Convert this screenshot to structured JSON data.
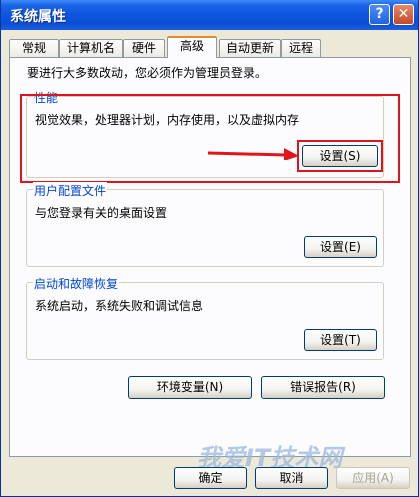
{
  "window": {
    "title": "系统属性",
    "help_glyph": "?",
    "close_glyph": "✕"
  },
  "tabs": [
    {
      "label": "常规"
    },
    {
      "label": "计算机名"
    },
    {
      "label": "硬件"
    },
    {
      "label": "高级",
      "active": true
    },
    {
      "label": "自动更新"
    },
    {
      "label": "远程"
    }
  ],
  "notice": "要进行大多数改动，您必须作为管理员登录。",
  "performance": {
    "label": "性能",
    "desc": "视觉效果，处理器计划，内存使用，以及虚拟内存",
    "button": "设置(S)"
  },
  "user_profiles": {
    "label": "用户配置文件",
    "desc": "与您登录有关的桌面设置",
    "button": "设置(E)"
  },
  "startup_recovery": {
    "label": "启动和故障恢复",
    "desc": "系统启动，系统失败和调试信息",
    "button": "设置(T)"
  },
  "env_button": "环境变量(N)",
  "error_button": "错误报告(R)",
  "footer": {
    "ok": "确定",
    "cancel": "取消",
    "apply": "应用(A)"
  },
  "watermark": "我爱IT技术网",
  "colors": {
    "highlight": "#e0141a",
    "group_label": "#0046d5",
    "title_bar": "#0b4fd6"
  }
}
